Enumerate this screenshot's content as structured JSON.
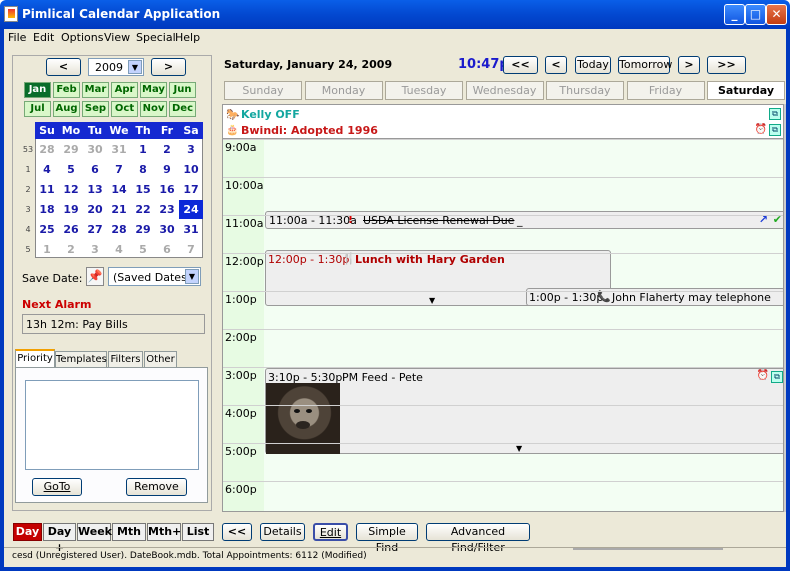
{
  "window": {
    "title": "Pimlical Calendar Application"
  },
  "menu": [
    "File",
    "Edit",
    "Options",
    "View",
    "Special",
    "Help"
  ],
  "nav": {
    "prev": "<",
    "year": "2009",
    "next": ">"
  },
  "months": [
    "Jan",
    "Feb",
    "Mar",
    "Apr",
    "May",
    "Jun",
    "Jul",
    "Aug",
    "Sep",
    "Oct",
    "Nov",
    "Dec"
  ],
  "selected_month": "Jan",
  "calendar": {
    "days_header": [
      "Su",
      "Mo",
      "Tu",
      "We",
      "Th",
      "Fr",
      "Sa"
    ],
    "weeks": [
      "53",
      "1",
      "2",
      "3",
      "4",
      "5"
    ],
    "rows": [
      [
        "28",
        "29",
        "30",
        "31",
        "1",
        "2",
        "3"
      ],
      [
        "4",
        "5",
        "6",
        "7",
        "8",
        "9",
        "10"
      ],
      [
        "11",
        "12",
        "13",
        "14",
        "15",
        "16",
        "17"
      ],
      [
        "18",
        "19",
        "20",
        "21",
        "22",
        "23",
        "24"
      ],
      [
        "25",
        "26",
        "27",
        "28",
        "29",
        "30",
        "31"
      ],
      [
        "1",
        "2",
        "3",
        "4",
        "5",
        "6",
        "7"
      ]
    ],
    "today": "24"
  },
  "save_date": {
    "label": "Save Date:",
    "select": "(Saved Dates)"
  },
  "alarm": {
    "label": "Next Alarm",
    "value": "13h 12m:  Pay Bills"
  },
  "tabs": [
    "Priority",
    "Templates",
    "Filters",
    "Other"
  ],
  "side_buttons": {
    "goto": "GoTo",
    "remove": "Remove"
  },
  "header": {
    "date": "Saturday, January 24, 2009",
    "time": "10:47p",
    "prev_prev": "<<",
    "prev": "<",
    "today": "Today",
    "tomorrow": "Tomorrow",
    "next": ">",
    "next_next": ">>"
  },
  "weekdays": [
    "Sunday",
    "Monday",
    "Tuesday",
    "Wednesday",
    "Thursday",
    "Friday",
    "Saturday"
  ],
  "allday": [
    {
      "text": "Kelly OFF",
      "color": "#14a7a0"
    },
    {
      "text": "Bwindi: Adopted 1996",
      "color": "#c71818"
    }
  ],
  "times": [
    "9:00a",
    "10:00a",
    "11:00a",
    "12:00p",
    "1:00p",
    "2:00p",
    "3:00p",
    "4:00p",
    "5:00p",
    "6:00p"
  ],
  "events": {
    "e1": {
      "time": "11:00a - 11:30a",
      "mark": "!",
      "title": "USDA License Renewal Due",
      "extra": "_"
    },
    "e2": {
      "time": "12:00p - 1:30p",
      "title": "Lunch with Hary Garden"
    },
    "e3": {
      "time": "1:00p - 1:30p",
      "title": "John Flaherty may telephone"
    },
    "e4": {
      "time": "3:10p - 5:30p",
      "title": "PM Feed - Pete"
    }
  },
  "views": [
    "Day",
    "Day +",
    "Week",
    "Mth",
    "Mth+",
    "List"
  ],
  "actions": {
    "back": "<<",
    "details": "Details",
    "edit": "Edit",
    "simple_find": "Simple Find",
    "advanced": "Advanced Find/Filter"
  },
  "status": "cesd (Unregistered User). DateBook.mdb. Total Appointments: 6112 (Modified)",
  "colors": {
    "title_bar": "#0039bf",
    "selected_day": "#0b28d8",
    "today_view_btn": "#c40000"
  }
}
